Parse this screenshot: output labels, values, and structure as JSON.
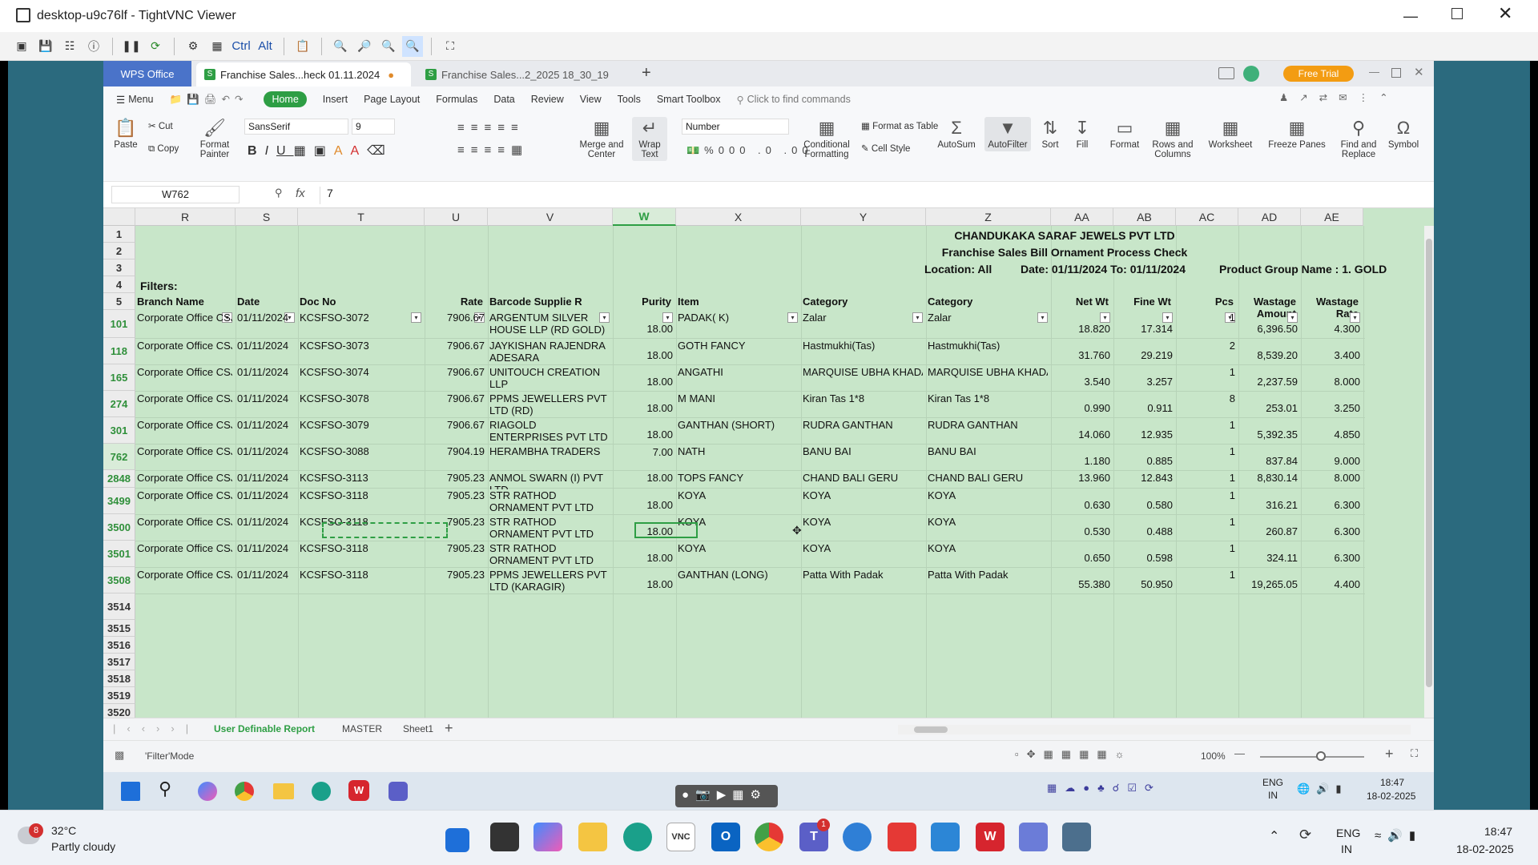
{
  "vnc": {
    "title": "desktop-u9c76lf - TightVNC Viewer",
    "ctrl": "Ctrl",
    "alt": "Alt"
  },
  "wps": {
    "tabs": {
      "home": "WPS Office",
      "active": "Franchise Sales...heck 01.11.2024",
      "other": "Franchise Sales...2_2025 18_30_19",
      "free_trial": "Free Trial"
    },
    "menu": [
      "Menu",
      "Home",
      "Insert",
      "Page Layout",
      "Formulas",
      "Data",
      "Review",
      "View",
      "Tools",
      "Smart Toolbox"
    ],
    "search_placeholder": "Click to find commands",
    "ribbon": {
      "paste": "Paste",
      "cut": "Cut",
      "copy": "Copy",
      "format_painter": "Format Painter",
      "font": "SansSerif",
      "size": "9",
      "merge": "Merge and Center",
      "wrap": "Wrap Text",
      "number_format": "Number",
      "cond": "Conditional Formatting",
      "format_table": "Format as Table",
      "cell_style": "Cell Style",
      "autosum": "AutoSum",
      "autofilter": "AutoFilter",
      "sort": "Sort",
      "fill": "Fill",
      "format": "Format",
      "rows_cols": "Rows and Columns",
      "worksheet": "Worksheet",
      "freeze": "Freeze Panes",
      "find": "Find and Replace",
      "symbol": "Symbol"
    },
    "namebox": "W762",
    "fx": "fx",
    "formula": "7",
    "columns": [
      "R",
      "S",
      "T",
      "U",
      "V",
      "W",
      "X",
      "Y",
      "Z",
      "AA",
      "AB",
      "AC",
      "AD",
      "AE"
    ],
    "title1": "CHANDUKAKA SARAF JEWELS PVT LTD",
    "title2": "Franchise Sales Bill Ornament Process Check",
    "location": "Location: All",
    "date_range": "Date: 01/11/2024  To: 01/11/2024",
    "group": "Product Group Name : 1. GOLD",
    "filters": "Filters:",
    "headers": [
      "Branch Name",
      "Date",
      "Doc No",
      "Rate",
      "Barcode Supplie R",
      "Purity",
      "Item",
      "Category",
      "Category",
      "Net Wt",
      "Fine Wt",
      "Pcs",
      "Wastage Amount",
      "Wastage Rate"
    ],
    "top_rows": [
      "1",
      "2",
      "3",
      "4",
      "5"
    ],
    "rows": [
      {
        "n": "101",
        "branch": "Corporate Office CSJ",
        "date": "01/11/2024",
        "doc": "KCSFSO-3072",
        "rate": "7906.67",
        "supplier": "ARGENTUM SILVER HOUSE LLP (RD GOLD)",
        "purity": "18.00",
        "item": "PADAK( K)",
        "cat1": "Zalar",
        "cat2": "Zalar",
        "net": "18.820",
        "fine": "17.314",
        "pcs": "1",
        "wamt": "6,396.50",
        "wrate": "4.300"
      },
      {
        "n": "118",
        "branch": "Corporate Office CSJ",
        "date": "01/11/2024",
        "doc": "KCSFSO-3073",
        "rate": "7906.67",
        "supplier": "JAYKISHAN RAJENDRA ADESARA",
        "purity": "18.00",
        "item": "GOTH FANCY",
        "cat1": "Hastmukhi(Tas)",
        "cat2": "Hastmukhi(Tas)",
        "net": "31.760",
        "fine": "29.219",
        "pcs": "2",
        "wamt": "8,539.20",
        "wrate": "3.400"
      },
      {
        "n": "165",
        "branch": "Corporate Office CSJ",
        "date": "01/11/2024",
        "doc": "KCSFSO-3074",
        "rate": "7906.67",
        "supplier": "UNITOUCH CREATION LLP",
        "purity": "18.00",
        "item": "ANGATHI",
        "cat1": "MARQUISE UBHA KHADA",
        "cat2": "MARQUISE UBHA KHADA",
        "net": "3.540",
        "fine": "3.257",
        "pcs": "1",
        "wamt": "2,237.59",
        "wrate": "8.000"
      },
      {
        "n": "274",
        "branch": "Corporate Office CSJ",
        "date": "01/11/2024",
        "doc": "KCSFSO-3078",
        "rate": "7906.67",
        "supplier": "PPMS JEWELLERS PVT LTD (RD)",
        "purity": "18.00",
        "item": "M MANI",
        "cat1": "Kiran Tas 1*8",
        "cat2": "Kiran Tas 1*8",
        "net": "0.990",
        "fine": "0.911",
        "pcs": "8",
        "wamt": "253.01",
        "wrate": "3.250"
      },
      {
        "n": "301",
        "branch": "Corporate Office CSJ",
        "date": "01/11/2024",
        "doc": "KCSFSO-3079",
        "rate": "7906.67",
        "supplier": "RIAGOLD ENTERPRISES PVT LTD RD",
        "purity": "18.00",
        "item": "GANTHAN (SHORT)",
        "cat1": "RUDRA GANTHAN",
        "cat2": "RUDRA GANTHAN",
        "net": "14.060",
        "fine": "12.935",
        "pcs": "1",
        "wamt": "5,392.35",
        "wrate": "4.850"
      },
      {
        "n": "762",
        "branch": "Corporate Office CSJ",
        "date": "01/11/2024",
        "doc": "KCSFSO-3088",
        "rate": "7904.19",
        "supplier": "HERAMBHA TRADERS",
        "purity": "7.00",
        "item": "NATH",
        "cat1": "BANU BAI",
        "cat2": "BANU BAI",
        "net": "1.180",
        "fine": "0.885",
        "pcs": "1",
        "wamt": "837.84",
        "wrate": "9.000"
      },
      {
        "n": "2848",
        "branch": "Corporate Office CSJ",
        "date": "01/11/2024",
        "doc": "KCSFSO-3113",
        "rate": "7905.23",
        "supplier": "ANMOL SWARN (I) PVT LTD",
        "purity": "18.00",
        "item": "TOPS FANCY",
        "cat1": "CHAND BALI GERU",
        "cat2": "CHAND BALI GERU",
        "net": "13.960",
        "fine": "12.843",
        "pcs": "1",
        "wamt": "8,830.14",
        "wrate": "8.000"
      },
      {
        "n": "3499",
        "branch": "Corporate Office CSJ",
        "date": "01/11/2024",
        "doc": "KCSFSO-3118",
        "rate": "7905.23",
        "supplier": "STR RATHOD ORNAMENT PVT LTD",
        "purity": "18.00",
        "item": "KOYA",
        "cat1": "KOYA",
        "cat2": "KOYA",
        "net": "0.630",
        "fine": "0.580",
        "pcs": "1",
        "wamt": "316.21",
        "wrate": "6.300"
      },
      {
        "n": "3500",
        "branch": "Corporate Office CSJ",
        "date": "01/11/2024",
        "doc": "KCSFSO-3118",
        "rate": "7905.23",
        "supplier": "STR RATHOD ORNAMENT PVT LTD",
        "purity": "18.00",
        "item": "KOYA",
        "cat1": "KOYA",
        "cat2": "KOYA",
        "net": "0.530",
        "fine": "0.488",
        "pcs": "1",
        "wamt": "260.87",
        "wrate": "6.300"
      },
      {
        "n": "3501",
        "branch": "Corporate Office CSJ",
        "date": "01/11/2024",
        "doc": "KCSFSO-3118",
        "rate": "7905.23",
        "supplier": "STR RATHOD ORNAMENT PVT LTD",
        "purity": "18.00",
        "item": "KOYA",
        "cat1": "KOYA",
        "cat2": "KOYA",
        "net": "0.650",
        "fine": "0.598",
        "pcs": "1",
        "wamt": "324.11",
        "wrate": "6.300"
      },
      {
        "n": "3508",
        "branch": "Corporate Office CSJ",
        "date": "01/11/2024",
        "doc": "KCSFSO-3118",
        "rate": "7905.23",
        "supplier": "PPMS JEWELLERS PVT LTD (KARAGIR)",
        "purity": "18.00",
        "item": "GANTHAN (LONG)",
        "cat1": "Patta With Padak",
        "cat2": "Patta With Padak",
        "net": "55.380",
        "fine": "50.950",
        "pcs": "1",
        "wamt": "19,265.05",
        "wrate": "4.400"
      }
    ],
    "empty_rows": [
      "3514",
      "3515",
      "3516",
      "3517",
      "3518",
      "3519",
      "3520"
    ],
    "sheets": [
      "User Definable Report",
      "MASTER",
      "Sheet1"
    ],
    "status_text": "'Filter'Mode",
    "zoom": "100%"
  },
  "remote_taskbar": {
    "lang1": "ENG",
    "lang2": "IN",
    "time": "18:47",
    "date": "18-02-2025"
  },
  "taskbar": {
    "weather_badge": "8",
    "temp": "32°C",
    "weather": "Partly cloudy",
    "lang1": "ENG",
    "lang2": "IN",
    "time": "18:47",
    "date": "18-02-2025",
    "teams_badge": "1"
  },
  "colors": {
    "grid_bg": "#c8e6c9",
    "accent_green": "#2e9e44",
    "row_num": "#2f8f3a"
  }
}
